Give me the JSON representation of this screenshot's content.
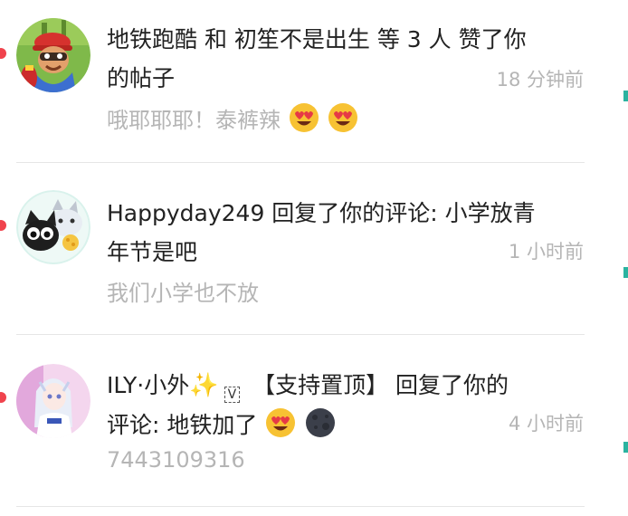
{
  "notifications": [
    {
      "avatar": "subway-surfer-avatar",
      "line1": "地铁跑酷 和 初笙不是出生 等 3 人 赞了你",
      "line2": "的帖子",
      "time": "18 分钟前",
      "subtext": "哦耶耶耶！泰裤辣",
      "emojis": [
        "heart-eyes-emoji",
        "heart-eyes-emoji"
      ]
    },
    {
      "avatar": "cartoon-cats-avatar",
      "line1": "Happyday249 回复了你的评论: 小学放青",
      "line2": "年节是吧",
      "time": "1 小时前",
      "subtext": "我们小学也不放"
    },
    {
      "avatar": "anime-girl-avatar",
      "name": "ILY·小外",
      "sparkle": "✨",
      "badge": "V",
      "line1_rest": "【支持置顶】 回复了你的",
      "line2": "评论: 地铁加了",
      "time": "4 小时前",
      "subtext": "7443109316",
      "emojis": [
        "heart-eyes-emoji",
        "new-moon-face-emoji"
      ]
    }
  ],
  "colors": {
    "unread_dot": "#f0434d",
    "primary_text": "#222222",
    "secondary_text": "#b5b5b5",
    "divider": "#e6e6e6",
    "edge_accent": "#2bb3a0"
  }
}
